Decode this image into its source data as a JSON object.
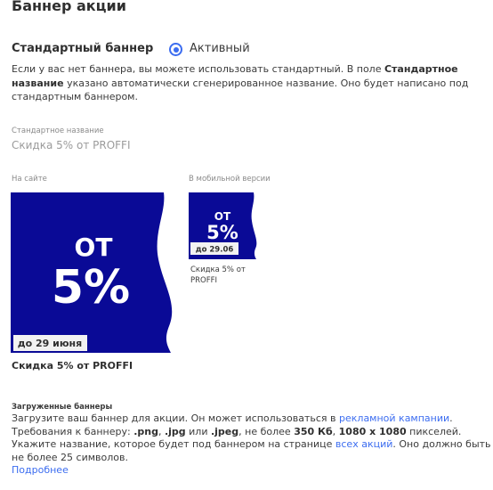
{
  "page_title": "Баннер акции",
  "standard_banner": {
    "label": "Стандартный баннер",
    "radio_label": "Активный",
    "desc_1": "Если у вас нет баннера, вы можете использовать стандартный. В поле ",
    "desc_bold": "Стандартное название",
    "desc_2": " указано автоматически сгенерированное название. Оно будет написано под стандартным баннером."
  },
  "standard_name": {
    "label": "Стандартное название",
    "value": "Скидка 5% от PROFFI"
  },
  "previews": {
    "site_label": "На сайте",
    "mobile_label": "В мобильной версии",
    "big_banner": {
      "from": "ОТ",
      "percent": "5%",
      "date": "до 29 июня",
      "caption": "Скидка 5% от PROFFI"
    },
    "small_banner": {
      "from": "ОТ",
      "percent": "5%",
      "date": "до 29.06",
      "caption": "Скидка 5% от PROFFI"
    }
  },
  "uploaded": {
    "title": "Загруженные баннеры",
    "t1": "Загрузите ваш баннер для акции. Он может использоваться в ",
    "link_campaigns": "рекламной кампании",
    "t2": ". Требования к баннеру: ",
    "fmt_png": ".png",
    "sep1": ", ",
    "fmt_jpg": ".jpg",
    "sep2": " или ",
    "fmt_jpeg": ".jpeg",
    "t3": ", не более ",
    "size": "350 Кб",
    "sep3": ", ",
    "dims": "1080 х 1080",
    "t4": " пикселей. Укажите название, которое будет под баннером на странице ",
    "link_all": "всех акций",
    "t5": ". Оно должно быть не более 25 символов.",
    "more_link": "Подробнее"
  },
  "colors": {
    "banner_blue": "#0a0a96",
    "accent": "#3c6df0"
  }
}
